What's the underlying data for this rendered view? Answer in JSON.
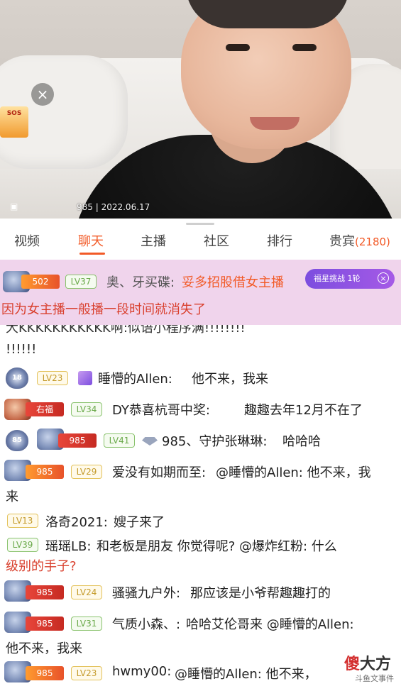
{
  "video": {
    "caption": "985 | 2022.06.17",
    "close_glyph": "×",
    "badge_text": "SOS"
  },
  "tabs": [
    {
      "label": "视频"
    },
    {
      "label": "聊天"
    },
    {
      "label": "主播"
    },
    {
      "label": "社区"
    },
    {
      "label": "排行"
    },
    {
      "label": "贵宾",
      "count": "(2180)"
    }
  ],
  "pinned": {
    "fan_badge": "502",
    "level": "LV37",
    "name": "奥、牙买碟:",
    "message_line1": "妥多招股借女主播",
    "message_line2": "因为女主播一般播一段时间就消失了",
    "promo": "福星挑战 1轮",
    "promo_close": "×"
  },
  "chat": {
    "partial_top": "大KKKKKKKKKKK啊:似语小程序满!!!!!!!!",
    "partial_cont": "!!!!!!",
    "rows": [
      {
        "shield": "18",
        "level": "LV23",
        "name": "睡懵的Allen:",
        "message": "他不来，我来"
      },
      {
        "fan": "右福",
        "level": "LV34",
        "name": "DY恭喜杭哥中奖:",
        "message": "趣趣去年12月不在了"
      },
      {
        "shield": "85",
        "fan": "985",
        "level": "LV41",
        "name": "985、守护张琳琳:",
        "message": "哈哈哈"
      },
      {
        "fan": "985",
        "level": "LV29",
        "name": "爱没有如期而至:",
        "message": "@睡懵的Allen: 他不来，我",
        "cont": "来"
      },
      {
        "level": "LV13",
        "name": "洛奇2021:",
        "message": "嫂子来了"
      },
      {
        "level": "LV39",
        "name": "瑶瑶LB:",
        "message": "和老板是朋友  你觉得呢? @爆炸红粉: 什么",
        "cont": "级别的手子?"
      },
      {
        "fan": "985",
        "level": "LV24",
        "name": "骚骚九户外:",
        "message": "那应该是小爷帮趣趣打的"
      },
      {
        "fan": "985",
        "level": "LV31",
        "name": "气质小森、:",
        "message": "哈哈艾伦哥来 @睡懵的Allen:",
        "cont": "他不来，我来"
      },
      {
        "fan": "985",
        "level": "LV23",
        "name": "hwmy00:",
        "message": "@睡懵的Allen: 他不来，"
      }
    ]
  },
  "watermark": {
    "text_red": "傻",
    "text_dark": "大方",
    "sub": "斗鱼文事件"
  },
  "colors": {
    "accent": "#f25a27",
    "pinned_bg": "#f0d4ec",
    "promo": "#7c4ddf"
  }
}
